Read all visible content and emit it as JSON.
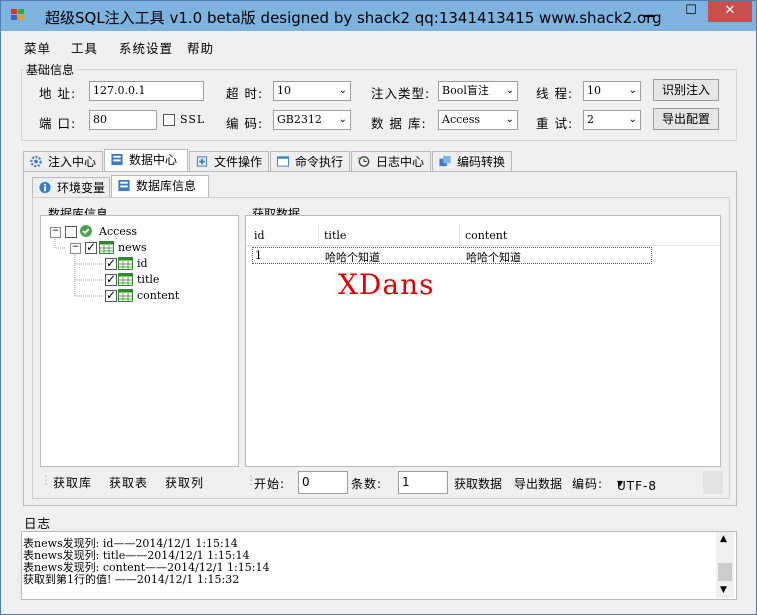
{
  "window": {
    "title": "超级SQL注入工具 v1.0 beta版 designed by shack2 qq:1341413415 www.shack2.org",
    "min_glyph": "▁",
    "max_glyph": "☐",
    "close_glyph": "✕"
  },
  "menu": [
    "菜单",
    "工具",
    "系统设置",
    "帮助"
  ],
  "basic": {
    "group_label": "基础信息",
    "address_label": "地 址:",
    "address_value": "127.0.0.1",
    "timeout_label": "超 时:",
    "timeout_value": "10",
    "inject_type_label": "注入类型:",
    "inject_type_value": "Bool盲注",
    "threads_label": "线 程:",
    "threads_value": "10",
    "identify_button": "识别注入",
    "port_label": "端 口:",
    "port_value": "80",
    "ssl_label": "SSL",
    "ssl_checked": false,
    "encoding_label": "编 码:",
    "encoding_value": "GB2312",
    "database_label": "数 据 库:",
    "database_value": "Access",
    "retry_label": "重 试:",
    "retry_value": "2",
    "export_button": "导出配置"
  },
  "main_tabs": [
    {
      "label": "注入中心",
      "icon": "gear-icon",
      "active": false
    },
    {
      "label": "数据中心",
      "icon": "database-icon",
      "active": true
    },
    {
      "label": "文件操作",
      "icon": "file-plus-icon",
      "active": false
    },
    {
      "label": "命令执行",
      "icon": "terminal-icon",
      "active": false
    },
    {
      "label": "日志中心",
      "icon": "history-icon",
      "active": false
    },
    {
      "label": "编码转换",
      "icon": "convert-icon",
      "active": false
    }
  ],
  "sub_tabs": [
    {
      "label": "环境变量",
      "icon": "info-icon",
      "active": false
    },
    {
      "label": "数据库信息",
      "icon": "database-icon",
      "active": true
    }
  ],
  "db_info": {
    "group_label": "数据库信息",
    "tree": {
      "db": "Access",
      "table": "news",
      "columns": [
        "id",
        "title",
        "content"
      ]
    },
    "buttons": [
      "获取库",
      "获取表",
      "获取列"
    ]
  },
  "fetch": {
    "group_label": "获取数据",
    "columns": [
      "id",
      "title",
      "content"
    ],
    "rows": [
      [
        "1",
        "哈哈个知道",
        "哈哈个知道"
      ]
    ],
    "watermark": "XDans",
    "start_label": "开始:",
    "start_value": "0",
    "count_label": "条数:",
    "count_value": "1",
    "get_data_button": "获取数据",
    "export_data_button": "导出数据",
    "encoding_label": "编码:",
    "encoding_value": "UTF-8"
  },
  "log": {
    "label": "日志",
    "lines": [
      "表news发现列: id——2014/12/1 1:15:14",
      "表news发现列: title——2014/12/1 1:15:14",
      "表news发现列: content——2014/12/1 1:15:14",
      "获取到第1行的值! ——2014/12/1 1:15:32"
    ]
  },
  "colors": {
    "titlebar": "#7eb2df",
    "close": "#c7504c",
    "watermark": "#dd0000"
  }
}
